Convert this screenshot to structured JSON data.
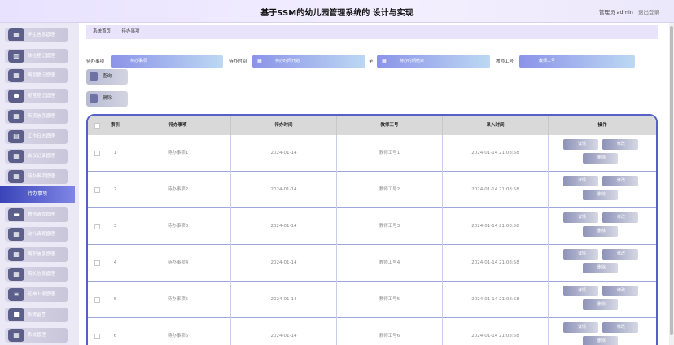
{
  "header": {
    "title": "基于SSM的幼儿园管理系统的 设计与实现",
    "user": "管理员 admin",
    "logout": "退出登录"
  },
  "sidebar": {
    "items": [
      {
        "label": "学生信息管理",
        "icon": "grid-icon"
      },
      {
        "label": "体检登记管理",
        "icon": "chart-icon"
      },
      {
        "label": "离园登记管理",
        "icon": "grid-icon"
      },
      {
        "label": "疫苗登记管理",
        "icon": "pin-icon"
      },
      {
        "label": "疾病信息管理",
        "icon": "grid-icon"
      },
      {
        "label": "工作日志管理",
        "icon": "doc-icon"
      },
      {
        "label": "会议记录管理",
        "icon": "grid-icon"
      },
      {
        "label": "待办事项管理",
        "icon": "grid-icon"
      }
    ],
    "active": "待办事项",
    "items_after": [
      {
        "label": "教师请假管理",
        "icon": "car-icon"
      },
      {
        "label": "幼儿请假管理",
        "icon": "grid-icon"
      },
      {
        "label": "离职信息管理",
        "icon": "grid-icon"
      },
      {
        "label": "院长信息管理",
        "icon": "grid-icon"
      },
      {
        "label": "延伸上报管理",
        "icon": "list-icon"
      },
      {
        "label": "系统留言",
        "icon": "folder-icon"
      },
      {
        "label": "系统管理",
        "icon": "grid-icon"
      }
    ]
  },
  "breadcrumb": {
    "home": "系统首页",
    "separator": "⋮",
    "current": "待办事项"
  },
  "search": {
    "todo_label": "待办事项",
    "todo_placeholder": "待办事项",
    "time_label": "待办时间",
    "time_start_placeholder": "待办时间开始",
    "range_sep": "至",
    "time_end_placeholder": "待办时间结束",
    "teacher_label": "教师工号",
    "teacher_placeholder": "教师工号",
    "query_button": "查询"
  },
  "actions": {
    "delete_button": "删除"
  },
  "table": {
    "headers": [
      "索引",
      "待办事项",
      "待办时间",
      "教师工号",
      "录入时间",
      "操作"
    ],
    "rows": [
      {
        "index": "1",
        "item": "待办事项1",
        "time": "2024-01-14",
        "teacher": "教师工号1",
        "created": "2024-01-14 21:08:58"
      },
      {
        "index": "2",
        "item": "待办事项2",
        "time": "2024-01-14",
        "teacher": "教师工号2",
        "created": "2024-01-14 21:08:58"
      },
      {
        "index": "3",
        "item": "待办事项3",
        "time": "2024-01-14",
        "teacher": "教师工号3",
        "created": "2024-01-14 21:08:58"
      },
      {
        "index": "4",
        "item": "待办事项4",
        "time": "2024-01-14",
        "teacher": "教师工号4",
        "created": "2024-01-14 21:08:58"
      },
      {
        "index": "5",
        "item": "待办事项5",
        "time": "2024-01-14",
        "teacher": "教师工号5",
        "created": "2024-01-14 21:08:58"
      },
      {
        "index": "6",
        "item": "待办事项6",
        "time": "2024-01-14",
        "teacher": "教师工号6",
        "created": "2024-01-14 21:08:58"
      }
    ],
    "op_detail": "详情",
    "op_edit": "修改",
    "op_delete": "删除"
  }
}
